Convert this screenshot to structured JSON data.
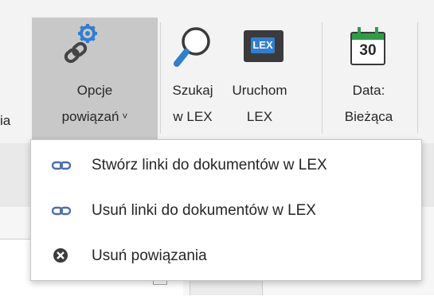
{
  "ribbon": {
    "truncated_label": "ia",
    "options_button": {
      "line1": "Opcje",
      "line2": "powiązań",
      "chevron": "˅"
    },
    "search_button": {
      "line1": "Szukaj",
      "line2": "w LEX"
    },
    "run_button": {
      "line1": "Uruchom",
      "line2": "LEX",
      "icon_text": "LEX"
    },
    "date_button": {
      "line1": "Data:",
      "line2": "Bieżąca",
      "icon_text": "30"
    }
  },
  "menu": {
    "items": [
      {
        "label": "Stwórz linki do dokumentów w LEX",
        "icon": "link-icon"
      },
      {
        "label": "Usuń linki do dokumentów w LEX",
        "icon": "link-icon"
      },
      {
        "label": "Usuń powiązania",
        "icon": "remove-circle-icon"
      }
    ]
  },
  "colors": {
    "accent_blue": "#2f7fd0",
    "lex_dark": "#3b3b3b",
    "calendar_green": "#2e9e44",
    "menu_icon_blue": "#4a6fb5"
  }
}
